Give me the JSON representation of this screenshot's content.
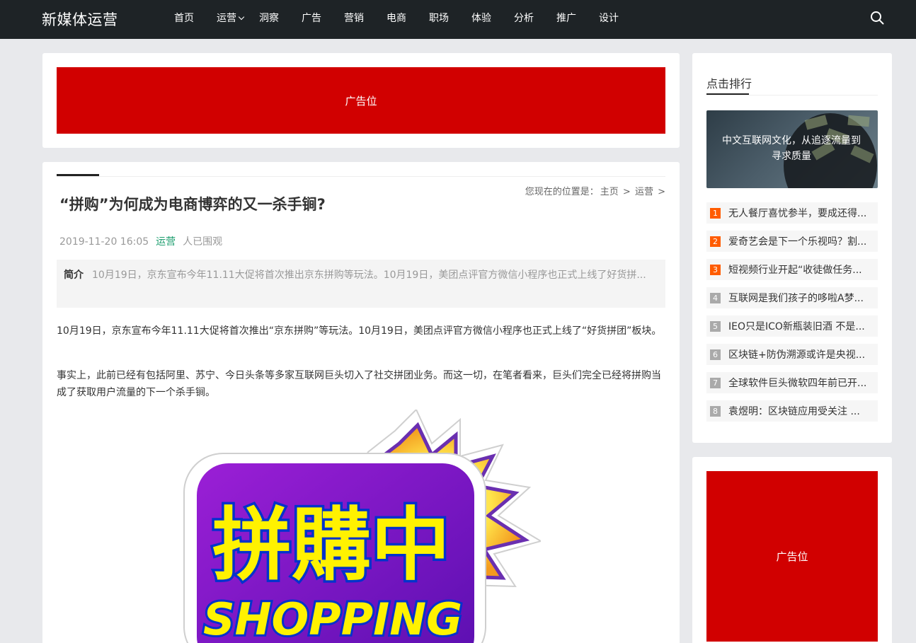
{
  "site": {
    "logo": "新媒体运营"
  },
  "nav": {
    "items": [
      {
        "label": "首页"
      },
      {
        "label": "运营",
        "has_dropdown": true
      },
      {
        "label": "洞察"
      },
      {
        "label": "广告"
      },
      {
        "label": "营销"
      },
      {
        "label": "电商"
      },
      {
        "label": "职场"
      },
      {
        "label": "体验"
      },
      {
        "label": "分析"
      },
      {
        "label": "推广"
      },
      {
        "label": "设计"
      }
    ],
    "search_icon": "search-icon"
  },
  "ads": {
    "top_label": "广告位",
    "side_label": "广告位",
    "color": "#d10000"
  },
  "article": {
    "breadcrumb": {
      "prefix": "您现在的位置是：",
      "home": "主页",
      "sep": ">",
      "category": "运营"
    },
    "title": "“拼购”为何成为电商博弈的又一杀手锏?",
    "date": "2019-11-20 16:05",
    "category": "运营",
    "views_text": "人已围观",
    "summary_label": "简介",
    "summary_text": "10月19日，京东宣布今年11.11大促将首次推出京东拼购等玩法。10月19日，美团点评官方微信小程序也正式上线了好货拼...",
    "paragraphs": [
      "10月19日，京东宣布今年11.11大促将首次推出“京东拼购”等玩法。10月19日，美团点评官方微信小程序也正式上线了“好货拼团”板块。",
      "事实上，此前已经有包括阿里、苏宁、今日头条等多家互联网巨头切入了社交拼团业务。而这一切，在笔者看来，巨头们完全已经将拼购当成了获取用户流量的下一个杀手锏。"
    ],
    "image": {
      "big_text": "拼購中",
      "sub_text": "SHOPPING"
    }
  },
  "ranking": {
    "title": "点击排行",
    "hero_caption": "中文互联网文化，从追逐流量到寻求质量",
    "items": [
      {
        "num": "1",
        "text": "无人餐厅喜忧参半，要成还得..."
      },
      {
        "num": "2",
        "text": "爱奇艺会是下一个乐视吗？割..."
      },
      {
        "num": "3",
        "text": "短视频行业开起“收徒做任务..."
      },
      {
        "num": "4",
        "text": "互联网是我们孩子的哆啦A梦..."
      },
      {
        "num": "5",
        "text": "IEO只是ICO新瓶装旧酒 不是..."
      },
      {
        "num": "6",
        "text": "区块链+防伪溯源或许是央视..."
      },
      {
        "num": "7",
        "text": "全球软件巨头微软四年前已开..."
      },
      {
        "num": "8",
        "text": "袁煜明：区块链应用受关注 ..."
      }
    ]
  }
}
